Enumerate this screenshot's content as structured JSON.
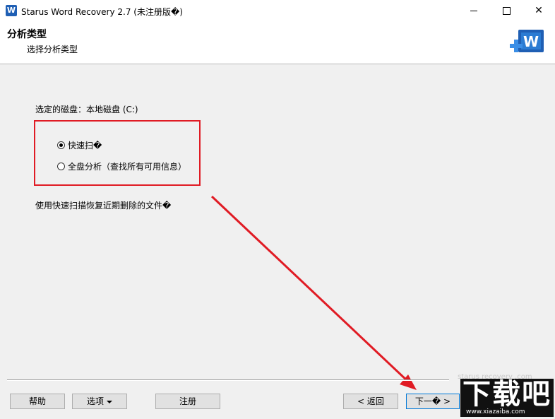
{
  "window": {
    "title": "Starus Word Recovery 2.7 (未注册版�)",
    "app_icon": "W",
    "controls": {
      "minimize": "minimize-icon",
      "maximize": "maximize-icon",
      "close": "✕"
    }
  },
  "header": {
    "title": "分析类型",
    "subtitle": "选择分析类型",
    "logo_icon": "word-logo-icon",
    "logo_letter": "W"
  },
  "content": {
    "disk_label": "选定的磁盘：本地磁盘 (C:)",
    "options": [
      {
        "label": "快速扫�",
        "checked": true
      },
      {
        "label": "全盘分析（查找所有可用信息）",
        "checked": false
      }
    ],
    "description": "使用快速扫描恢复近期删除的文件�"
  },
  "footer": {
    "help": "帮助",
    "options": "选项",
    "register": "注册",
    "back": "< 返回",
    "next": "下一� >"
  },
  "watermark": {
    "faded_text": "starus recovery .com",
    "logo_text": "下载吧",
    "url": "www.xiazaiba.com"
  },
  "colors": {
    "highlight": "#e01b24",
    "accent": "#0078d7",
    "logo_blue": "#1f5fb4"
  }
}
